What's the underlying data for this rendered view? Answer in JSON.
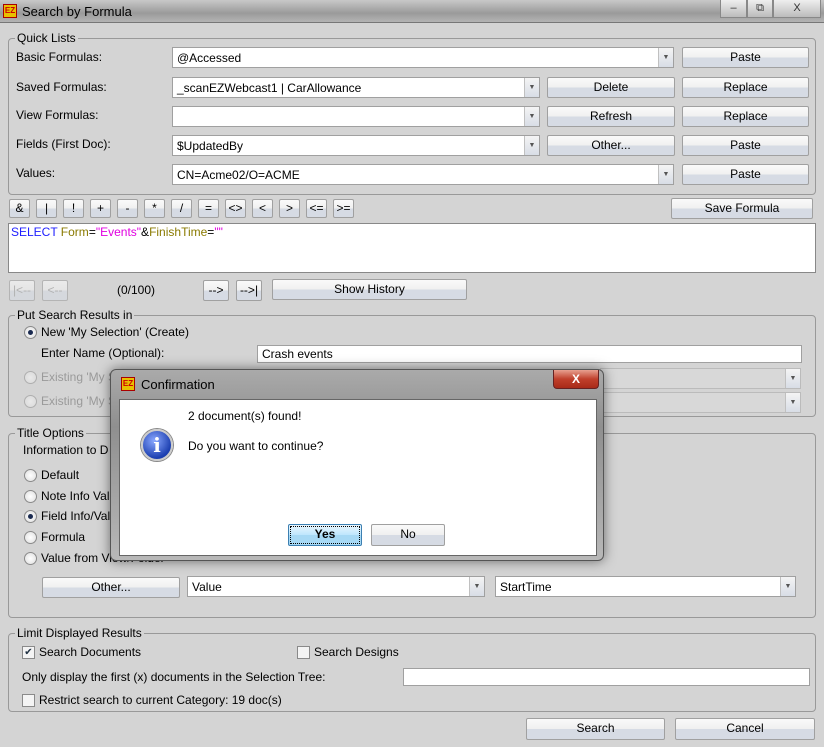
{
  "window": {
    "title": "Search by Formula",
    "min": "–",
    "restore": "⧉",
    "close": "X"
  },
  "quick_lists": {
    "legend": "Quick Lists",
    "basic": {
      "label": "Basic Formulas:",
      "value": "@Accessed",
      "paste": "Paste"
    },
    "saved": {
      "label": "Saved Formulas:",
      "value": "_scanEZWebcast1 | CarAllowance",
      "delete": "Delete",
      "replace": "Replace"
    },
    "view": {
      "label": "View Formulas:",
      "value": "",
      "refresh": "Refresh",
      "replace": "Replace"
    },
    "fields": {
      "label": "Fields (First Doc):",
      "value": "$UpdatedBy",
      "other": "Other...",
      "paste": "Paste"
    },
    "values": {
      "label": "Values:",
      "value": "CN=Acme02/O=ACME",
      "paste": "Paste"
    }
  },
  "operators": [
    "&",
    "|",
    "!",
    "+",
    "-",
    "*",
    "/",
    "=",
    "<>",
    "<",
    ">",
    "<=",
    ">="
  ],
  "save_formula": "Save Formula",
  "formula": {
    "t1": "SELECT",
    "t2": " Form",
    "t3": "=",
    "t4": "\"Events\"",
    "t5": "&",
    "t6": "FinishTime",
    "t7": "=",
    "t8": "\"\""
  },
  "history": {
    "first": "|<--",
    "prev": "<--",
    "counter": "(0/100)",
    "next": "-->",
    "last": "-->|",
    "show": "Show History"
  },
  "put_results": {
    "legend": "Put Search Results in",
    "new": "New 'My Selection' (Create)",
    "enter_name": "Enter Name (Optional):",
    "name_value": "Crash events",
    "existing1": "Existing 'My S",
    "existing2": "Existing 'My S"
  },
  "title_options": {
    "legend": "Title Options",
    "info": "Information to D",
    "default": "Default",
    "note": "Note Info Val",
    "field": "Field Info/Val",
    "formula": "Formula",
    "view": "Value from View/Folder",
    "other": "Other...",
    "combo1": "Value",
    "combo2": "StartTime"
  },
  "limit": {
    "legend": "Limit Displayed Results",
    "search_docs": "Search Documents",
    "search_designs": "Search Designs",
    "only_display": "Only display the first (x) documents in the Selection Tree:",
    "only_value": "",
    "restrict": "Restrict search to current Category: 19 doc(s)"
  },
  "search": "Search",
  "cancel": "Cancel",
  "dialog": {
    "title": "Confirmation",
    "line1": "2 document(s) found!",
    "line2": "Do you want to continue?",
    "yes": "Yes",
    "no": "No",
    "close": "X"
  },
  "colors": {
    "keyword": "#2020ff",
    "field": "#8a7a00",
    "string": "#e000e0"
  }
}
